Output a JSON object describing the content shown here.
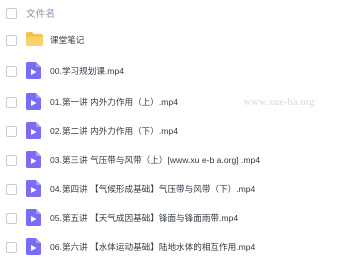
{
  "header": {
    "column_label": "文件名",
    "sort_icon": "arrow-up-icon"
  },
  "watermark": "www.xue-ba.org",
  "files": [
    {
      "name": "课堂笔记",
      "type": "folder",
      "icon": "folder-icon"
    },
    {
      "name": "00.学习规划课.mp4",
      "type": "video",
      "icon": "video-icon"
    },
    {
      "name": "01.第一讲 内外力作用（上）.mp4",
      "type": "video",
      "icon": "video-icon"
    },
    {
      "name": "02.第二讲 内外力作用（下）.mp4",
      "type": "video",
      "icon": "video-icon"
    },
    {
      "name": "03.第三讲 气压带与风带（上）[www.xu e-b a.org] .mp4",
      "type": "video",
      "icon": "video-icon"
    },
    {
      "name": "04.第四讲 【气候形成基础】气压带与风带（下）.mp4",
      "type": "video",
      "icon": "video-icon"
    },
    {
      "name": "05.第五讲 【天气成因基础】锋面与锋面雨带.mp4",
      "type": "video",
      "icon": "video-icon"
    },
    {
      "name": "06.第六讲 【水体运动基础】陆地水体的相互作用.mp4",
      "type": "video",
      "icon": "video-icon"
    }
  ],
  "colors": {
    "folder": "#f5c34b",
    "video": "#7b6cf6",
    "text": "#333a45",
    "header_text": "#8a8f99",
    "accent": "#4a90f0"
  }
}
